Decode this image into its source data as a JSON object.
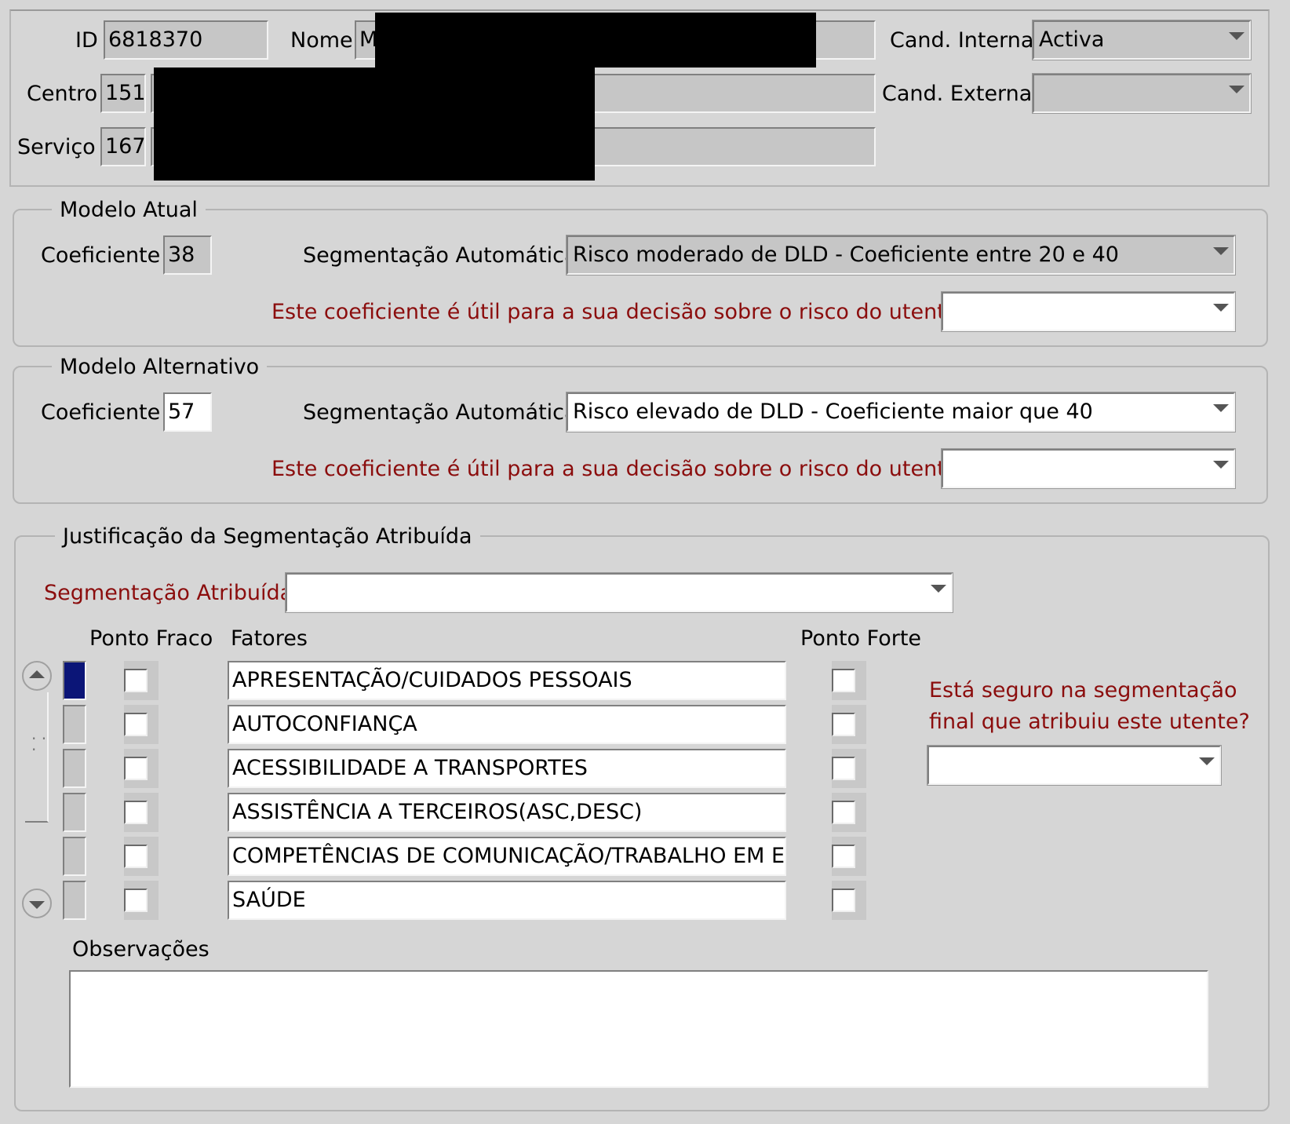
{
  "header": {
    "id_label": "ID",
    "id_value": "6818370",
    "nome_label": "Nome",
    "nome_value": "M",
    "centro_label": "Centro",
    "centro_value": "151",
    "servico_label": "Serviço",
    "servico_value": "167",
    "cand_interna_label": "Cand. Interna",
    "cand_interna_value": "Activa",
    "cand_externa_label": "Cand. Externa",
    "cand_externa_value": ""
  },
  "modelo_atual": {
    "title": "Modelo Atual",
    "coef_label": "Coeficiente",
    "coef_value": "38",
    "seg_label": "Segmentação Automática",
    "seg_value": "Risco moderado de DLD - Coeficiente entre 20 e 40",
    "question": "Este coeficiente é útil para a sua decisão sobre o risco do utente?",
    "answer": ""
  },
  "modelo_alternativo": {
    "title": "Modelo Alternativo",
    "coef_label": "Coeficiente",
    "coef_value": "57",
    "seg_label": "Segmentação Automática",
    "seg_value": "Risco elevado de DLD - Coeficiente maior que 40",
    "question": "Este coeficiente é útil para a sua decisão sobre o risco do utente?",
    "answer": ""
  },
  "justificacao": {
    "title": "Justificação da Segmentação Atribuída",
    "seg_atribuida_label": "Segmentação Atribuída",
    "seg_atribuida_value": "",
    "col_ponto_fraco": "Ponto Fraco",
    "col_fatores": "Fatores",
    "col_ponto_forte": "Ponto Forte",
    "fatores": [
      "APRESENTAÇÃO/CUIDADOS PESSOAIS",
      "AUTOCONFIANÇA",
      "ACESSIBILIDADE A TRANSPORTES",
      "ASSISTÊNCIA A TERCEIROS(ASC,DESC)",
      "COMPETÊNCIAS DE COMUNICAÇÃO/TRABALHO EM EG",
      "SAÚDE"
    ],
    "seguro_question_line1": "Está seguro na segmentação",
    "seguro_question_line2": "final que atribuiu este utente?",
    "seguro_answer": "",
    "observacoes_label": "Observações",
    "observacoes_value": ""
  },
  "colors": {
    "background": "#d6d6d6",
    "required_label": "#8b0d0d",
    "selected_row": "#0b1577"
  },
  "icons": [
    "dropdown-arrow-icon",
    "scroll-up-icon",
    "scroll-down-icon"
  ]
}
